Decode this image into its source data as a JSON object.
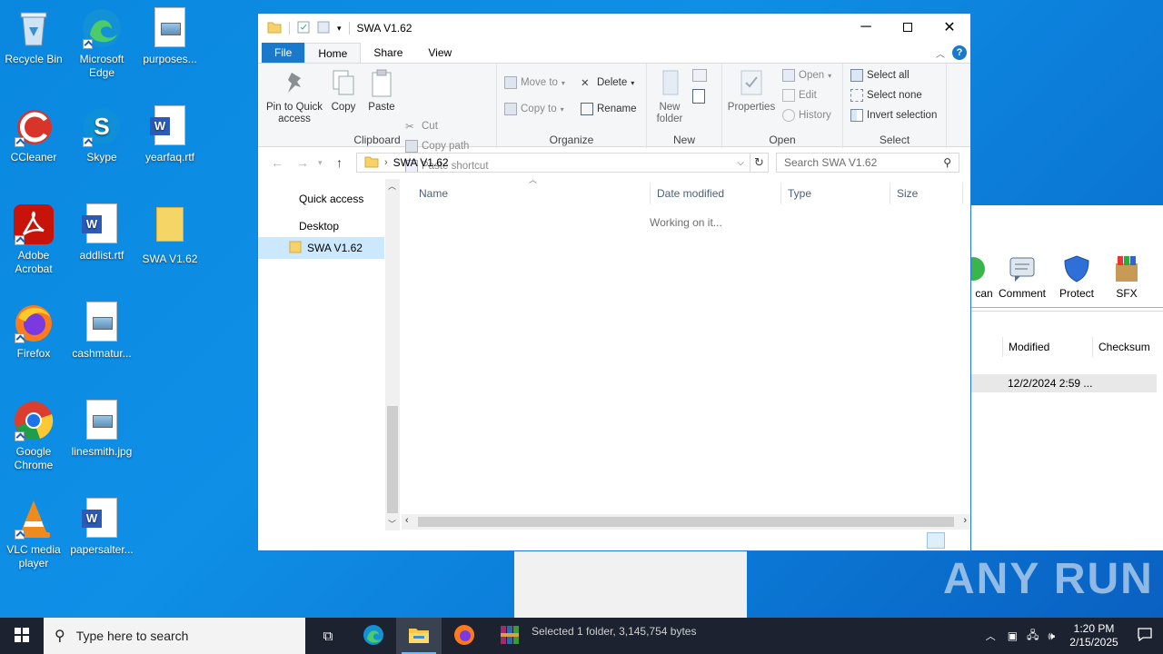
{
  "desktop": {
    "icons": [
      {
        "label": "Recycle Bin"
      },
      {
        "label": "Microsoft Edge"
      },
      {
        "label": "purposes..."
      },
      {
        "label": "CCleaner"
      },
      {
        "label": "Skype"
      },
      {
        "label": "yearfaq.rtf"
      },
      {
        "label": "Adobe Acrobat"
      },
      {
        "label": "addlist.rtf"
      },
      {
        "label": "SWA V1.62"
      },
      {
        "label": "Firefox"
      },
      {
        "label": "cashmatur..."
      },
      {
        "label": "Google Chrome"
      },
      {
        "label": "linesmith.jpg"
      },
      {
        "label": "VLC media player"
      },
      {
        "label": "papersalter..."
      }
    ]
  },
  "explorer": {
    "title": "SWA V1.62",
    "tabs": {
      "file": "File",
      "home": "Home",
      "share": "Share",
      "view": "View"
    },
    "ribbon": {
      "clipboard": {
        "label": "Clipboard",
        "pin": "Pin to Quick access",
        "copy": "Copy",
        "paste": "Paste",
        "cut": "Cut",
        "copy_path": "Copy path",
        "paste_shortcut": "Paste shortcut"
      },
      "organize": {
        "label": "Organize",
        "move_to": "Move to",
        "copy_to": "Copy to",
        "delete": "Delete",
        "rename": "Rename"
      },
      "new": {
        "label": "New",
        "new_folder": "New folder"
      },
      "open": {
        "label": "Open",
        "properties": "Properties",
        "open": "Open",
        "edit": "Edit",
        "history": "History"
      },
      "select": {
        "label": "Select",
        "select_all": "Select all",
        "select_none": "Select none",
        "invert": "Invert selection"
      }
    },
    "address": {
      "path": "SWA V1.62",
      "search_placeholder": "Search SWA V1.62"
    },
    "nav": {
      "quick_access": "Quick access",
      "desktop": "Desktop",
      "selected": "SWA V1.62"
    },
    "columns": {
      "name": "Name",
      "date": "Date modified",
      "type": "Type",
      "size": "Size"
    },
    "status": "Working on it..."
  },
  "rar": {
    "tools": {
      "scan": "can",
      "comment": "Comment",
      "protect": "Protect",
      "sfx": "SFX"
    },
    "columns": {
      "modified": "Modified",
      "checksum": "Checksum"
    },
    "row_modified": "12/2/2024 2:59 ..."
  },
  "taskbar": {
    "search_placeholder": "Type here to search",
    "status_text": "Selected 1 folder, 3,145,754 bytes",
    "time": "1:20 PM",
    "date": "2/15/2025"
  },
  "watermark": "ANY RUN"
}
